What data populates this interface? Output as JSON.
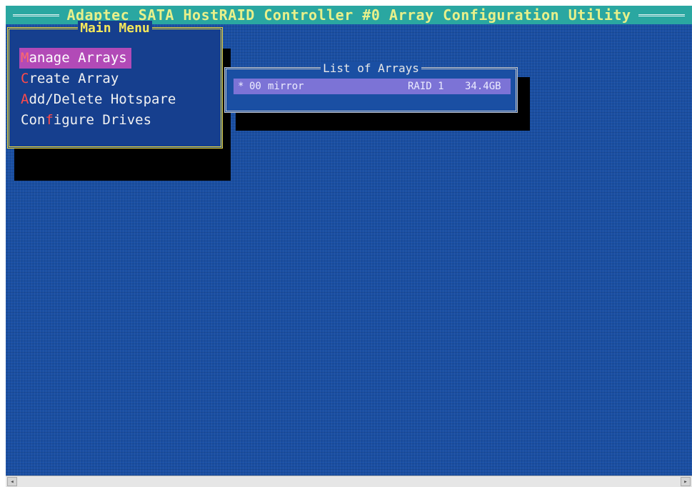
{
  "title_bar": {
    "text": "Adaptec SATA HostRAID Controller #0 Array Configuration Utility"
  },
  "main_menu": {
    "title": "Main Menu",
    "items": [
      {
        "hotkey": "M",
        "rest": "anage Arrays",
        "selected": true
      },
      {
        "hotkey": "C",
        "rest": "reate Array",
        "selected": false
      },
      {
        "hotkey": "A",
        "rest": "dd/Delete Hotspare",
        "selected": false
      },
      {
        "pre": "Con",
        "hotkey": "f",
        "rest": "igure Drives",
        "selected": false
      }
    ]
  },
  "array_list": {
    "title": "List of Arrays",
    "rows": [
      {
        "marker": "*",
        "id": "00",
        "name": "mirror",
        "level": "RAID 1",
        "size": "34.4GB"
      }
    ]
  },
  "scrollbar": {
    "left_arrow": "◂",
    "right_arrow": "▸"
  },
  "colors": {
    "background": "#1a4fa3",
    "title_bar": "#2aa7a1",
    "menu_border": "#f0dc3c",
    "selection": "#b24ab7",
    "row_highlight": "#7c73d6",
    "hotkey": "#ff4a4a"
  }
}
